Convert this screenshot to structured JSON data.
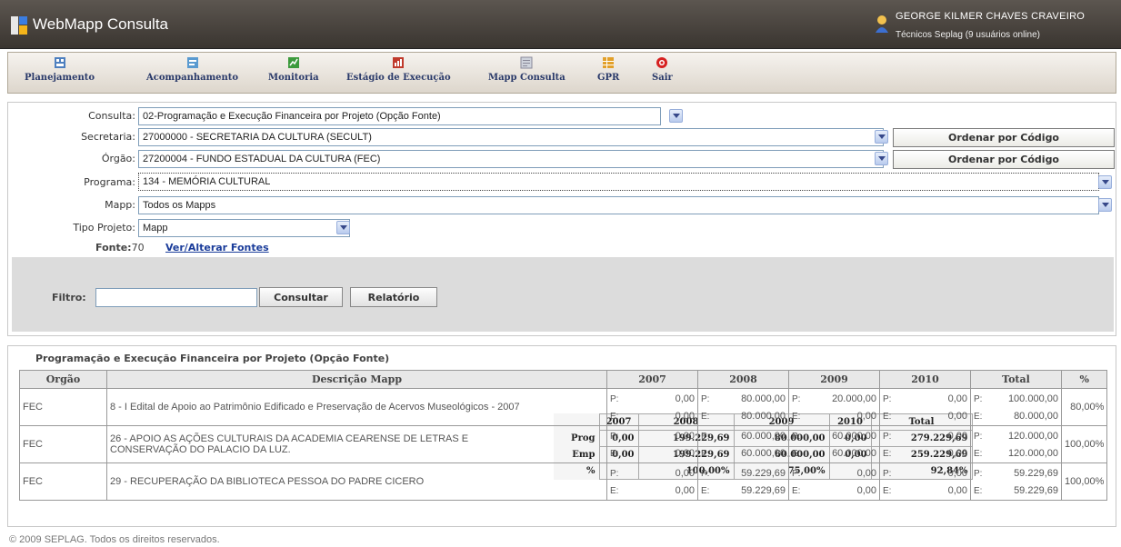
{
  "app": {
    "title": "WebMapp Consulta"
  },
  "user": {
    "name": "GEORGE KILMER CHAVES CRAVEIRO",
    "role": "Técnicos Seplag   (9 usuários online)"
  },
  "toolbar": [
    {
      "label": "Planejamento",
      "icon": "planning-icon",
      "color": "#4d7fbf"
    },
    {
      "label": "Acompanhamento",
      "icon": "tracking-icon",
      "color": "#5a9ad0"
    },
    {
      "label": "Monitoria",
      "icon": "monitoring-icon",
      "color": "#3c9a3c"
    },
    {
      "label": "Estágio de Execução",
      "icon": "execution-stage-icon",
      "color": "#c0392b"
    },
    {
      "label": "Mapp Consulta",
      "icon": "mapp-query-icon",
      "color": "#8a8a9a"
    },
    {
      "label": "GPR",
      "icon": "gpr-icon",
      "color": "#e2a02a"
    },
    {
      "label": "Sair",
      "icon": "exit-icon",
      "color": "#d62020"
    }
  ],
  "form": {
    "consulta": {
      "label": "Consulta:",
      "value": "02-Programação e Execução Financeira por Projeto (Opção Fonte)"
    },
    "secretaria": {
      "label": "Secretaria:",
      "value": "27000000 - SECRETARIA DA CULTURA (SECULT)",
      "order_button": "Ordenar por Código"
    },
    "orgao": {
      "label": "Órgão:",
      "value": "27200004 - FUNDO ESTADUAL DA CULTURA (FEC)",
      "order_button": "Ordenar por Código"
    },
    "programa": {
      "label": "Programa:",
      "value": "134 - MEMÓRIA CULTURAL"
    },
    "mapp": {
      "label": "Mapp:",
      "value": "Todos os Mapps"
    },
    "tipo_projeto": {
      "label": "Tipo Projeto:",
      "value": "Mapp"
    },
    "fonte": {
      "label": "Fonte:",
      "value": "70",
      "link": "Ver/Alterar Fontes"
    },
    "filtro": {
      "label": "Filtro:",
      "value": "",
      "consultar_button": "Consultar",
      "relatorio_button": "Relatório"
    }
  },
  "summary": {
    "headers": [
      "2007",
      "2008",
      "2009",
      "2010",
      "Total"
    ],
    "rows": [
      {
        "label": "Prog",
        "values": [
          "0,00",
          "199.229,69",
          "80.000,00",
          "0,00",
          "279.229,69"
        ]
      },
      {
        "label": "Emp",
        "values": [
          "0,00",
          "199.229,69",
          "60.000,00",
          "0,00",
          "259.229,69"
        ]
      },
      {
        "label": "%",
        "values": [
          "",
          "100,00%",
          "75,00%",
          "",
          "92,84%"
        ]
      }
    ]
  },
  "results": {
    "title": "Programação e Execução Financeira por Projeto (Opção Fonte)",
    "columns": [
      "Orgão",
      "Descrição Mapp",
      "2007",
      "2008",
      "2009",
      "2010",
      "Total",
      "%"
    ],
    "p_label": "P:",
    "e_label": "E:",
    "rows": [
      {
        "orgao": "FEC",
        "descricao": "8 - I Edital de Apoio ao Patrimônio Edificado e Preservação de Acervos Museológicos - 2007",
        "p": [
          "0,00",
          "80.000,00",
          "20.000,00",
          "0,00",
          "100.000,00"
        ],
        "e": [
          "0,00",
          "80.000,00",
          "0,00",
          "0,00",
          "80.000,00"
        ],
        "pct": "80,00%"
      },
      {
        "orgao": "FEC",
        "descricao": "26 - APOIO AS AÇÕES CULTURAIS DA ACADEMIA CEARENSE DE LETRAS E CONSERVAÇÃO DO PALACIO DA LUZ.",
        "p": [
          "0,00",
          "60.000,00",
          "60.000,00",
          "0,00",
          "120.000,00"
        ],
        "e": [
          "0,00",
          "60.000,00",
          "60.000,00",
          "0,00",
          "120.000,00"
        ],
        "pct": "100,00%"
      },
      {
        "orgao": "FEC",
        "descricao": "29 - RECUPERAÇÃO DA BIBLIOTECA PESSOA DO PADRE CICERO",
        "p": [
          "0,00",
          "59.229,69",
          "0,00",
          "0,00",
          "59.229,69"
        ],
        "e": [
          "0,00",
          "59.229,69",
          "0,00",
          "0,00",
          "59.229,69"
        ],
        "pct": "100,00%"
      }
    ]
  },
  "footer": "© 2009 SEPLAG. Todos os direitos reservados."
}
